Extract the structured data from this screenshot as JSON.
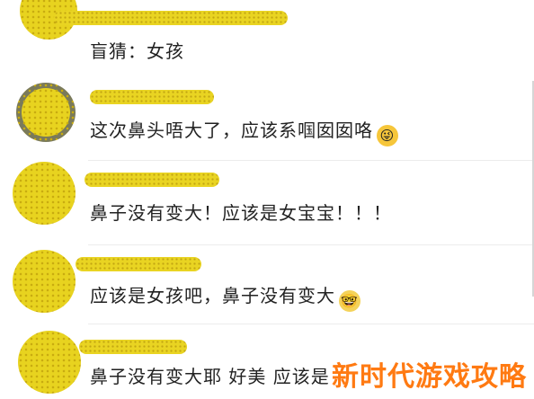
{
  "comments": [
    {
      "text": "盲猜：女孩",
      "emoji": ""
    },
    {
      "text": "这次鼻头唔大了，应该系啯囡囡咯",
      "emoji": "tongue-out-emoji"
    },
    {
      "text": "鼻子没有变大！应该是女宝宝！！！",
      "emoji": ""
    },
    {
      "text": "应该是女孩吧，鼻子没有变大",
      "emoji": "glasses-emoji"
    },
    {
      "text": "鼻子没有变大耶 好美 应该是",
      "emoji": ""
    }
  ],
  "watermark": "新时代游戏攻略",
  "colors": {
    "redaction": "#e8d31f",
    "watermark": "#ff7a12"
  }
}
